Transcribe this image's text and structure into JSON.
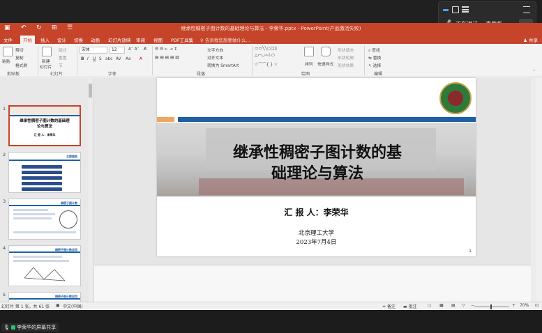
{
  "meeting": {
    "speaking_label": "正在讲话:",
    "speaker": "李荣华",
    "share_label": "李荣华的屏幕共享"
  },
  "window": {
    "title": "继承性稠密子图计数的基础理论与算法 - 李荣华.pptx - PowerPoint(产品激活失败)"
  },
  "menu": {
    "tabs": [
      "文件",
      "开始",
      "插入",
      "设计",
      "切换",
      "动画",
      "幻灯片放映",
      "审阅",
      "视图",
      "PDF工具集"
    ],
    "active": "开始",
    "tell_me": "♀ 告诉我您想要做什么...",
    "share": "共享"
  },
  "ribbon": {
    "clipboard": {
      "paste": "粘贴",
      "cut": "剪切",
      "copy": "复制",
      "format_painter": "格式刷",
      "label": "剪贴板"
    },
    "slides": {
      "new_slide": "新建",
      "new_slide2": "幻灯片",
      "layout": "版式",
      "reset": "重置",
      "section": "节",
      "label": "幻灯片"
    },
    "font": {
      "name": "宋体",
      "size": "12",
      "label": "字体"
    },
    "paragraph": {
      "text_direction": "文字方向",
      "align_text": "对齐文本",
      "smartart": "转换为 SmartArt",
      "label": "段落"
    },
    "drawing": {
      "arrange": "排列",
      "quick_styles": "快速样式",
      "shape_fill": "形状填充",
      "shape_outline": "形状轮廓",
      "shape_effects": "形状效果",
      "label": "绘图"
    },
    "editing": {
      "find": "查找",
      "replace": "替换",
      "select": "选择",
      "label": "编辑"
    }
  },
  "thumbnails": [
    {
      "num": "1",
      "title": "继承性稠密子图计数的基础理论与算法",
      "sub": "汇 报 人：李荣华"
    },
    {
      "num": "2",
      "title": "主要提纲"
    },
    {
      "num": "3",
      "title": "稠密子图计数"
    },
    {
      "num": "4",
      "title": "稠密子图计数应用"
    },
    {
      "num": "5",
      "title": "稠密子图计数应用"
    }
  ],
  "slide": {
    "title_line1": "继承性稠密子图计数的基",
    "title_line2": "础理论与算法",
    "reporter": "汇 报 人：李荣华",
    "university": "北京理工大学",
    "date": "2023年7月4日",
    "page": "1"
  },
  "status": {
    "slide_of": "幻灯片 第 1 张，共 61 张",
    "lang": "中文(中国)",
    "notes": "备注",
    "comments": "批注",
    "zoom": "70%"
  }
}
